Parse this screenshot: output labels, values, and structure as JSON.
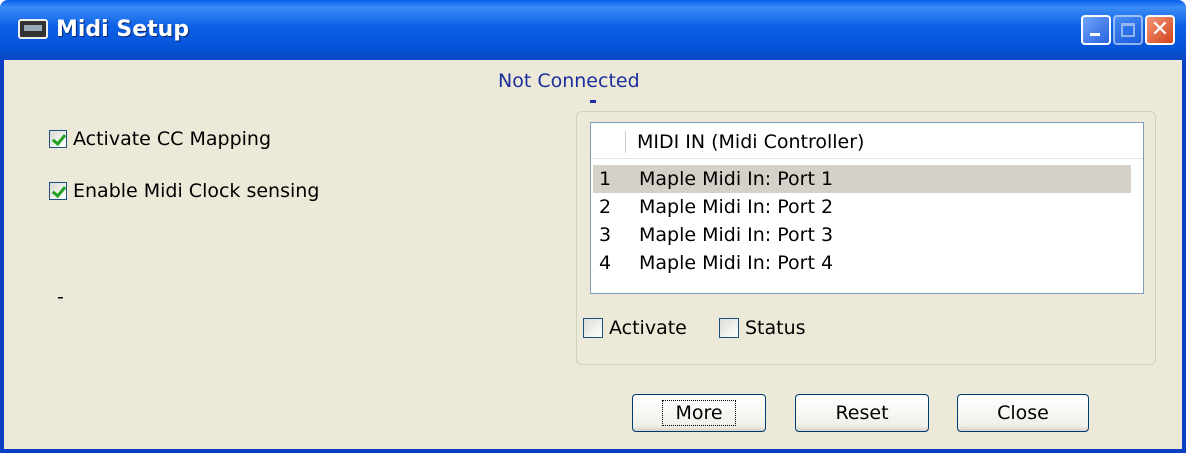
{
  "window": {
    "title": "Midi Setup",
    "status": "Not Connected"
  },
  "options": {
    "cc_mapping": {
      "label": "Activate CC Mapping",
      "checked": true
    },
    "clock_sensing": {
      "label": "Enable Midi Clock sensing",
      "checked": true
    },
    "misc_text": "-"
  },
  "midi_in": {
    "header": "MIDI IN (Midi Controller)",
    "ports": [
      {
        "num": "1",
        "name": "Maple Midi In: Port 1",
        "selected": true
      },
      {
        "num": "2",
        "name": "Maple Midi In: Port 2",
        "selected": false
      },
      {
        "num": "3",
        "name": "Maple Midi In: Port 3",
        "selected": false
      },
      {
        "num": "4",
        "name": "Maple Midi In: Port 4",
        "selected": false
      }
    ],
    "activate_label": "Activate",
    "status_label": "Status"
  },
  "buttons": {
    "more": "More",
    "reset": "Reset",
    "close": "Close"
  },
  "titlebar_buttons": {
    "close_glyph": "✕"
  }
}
